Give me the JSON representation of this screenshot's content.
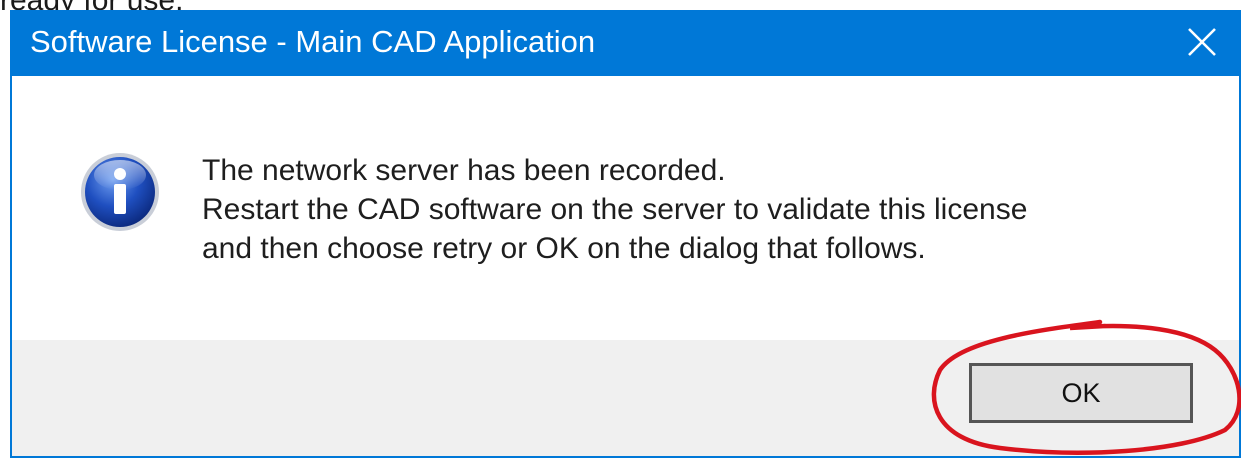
{
  "page": {
    "top_fragment": "ready for use."
  },
  "dialog": {
    "title": "Software License - Main CAD Application",
    "close_icon": "close-icon",
    "info_icon": "information-icon",
    "message_lines": [
      "The network server has been recorded.",
      "Restart the CAD software on the server to validate this license",
      "and then choose retry or OK on the dialog that follows."
    ],
    "ok_label": "OK"
  },
  "colors": {
    "titlebar": "#0078d7",
    "footer": "#f0f0f0",
    "annotation_circle": "#d9141e"
  }
}
